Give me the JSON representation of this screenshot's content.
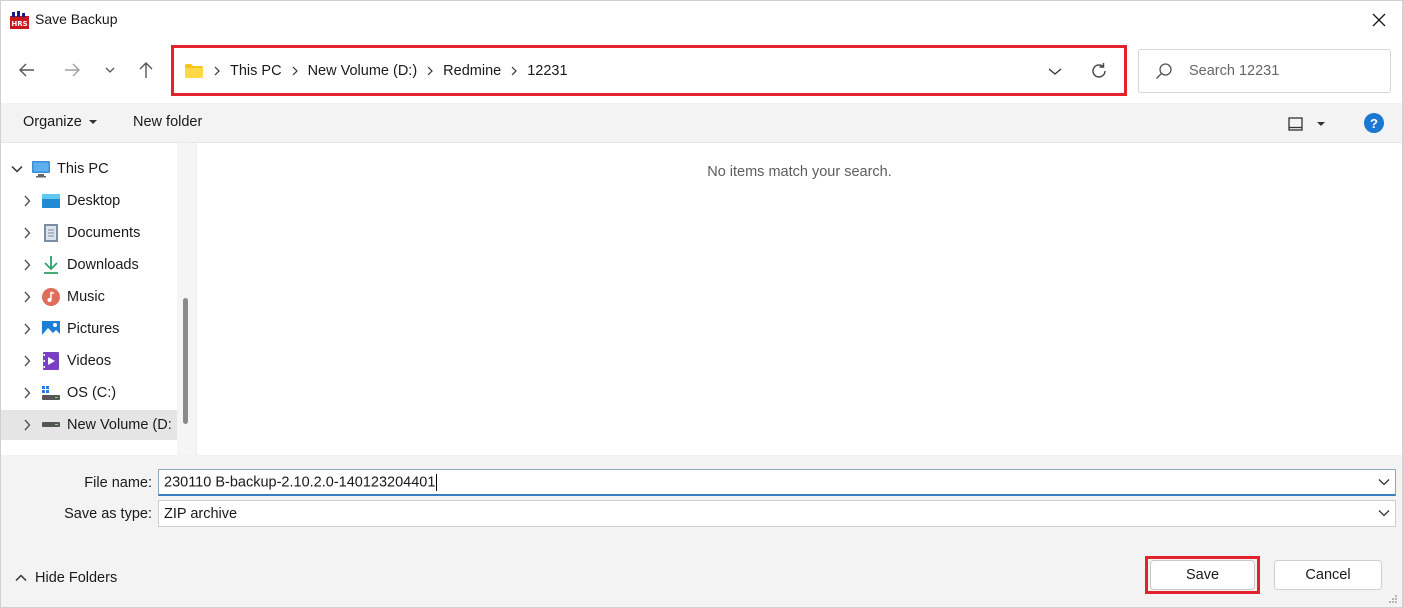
{
  "window": {
    "title": "Save Backup",
    "app_icon": "hrs-app-icon",
    "close_icon": "close-icon"
  },
  "nav": {
    "back_icon": "arrow-left-icon",
    "forward_icon": "arrow-right-icon",
    "recent_icon": "chevron-down-icon",
    "up_icon": "arrow-up-icon"
  },
  "address": {
    "folder_icon": "folder-icon",
    "crumbs": [
      "This PC",
      "New Volume (D:)",
      "Redmine",
      "12231"
    ],
    "dropdown_icon": "chevron-down-icon",
    "refresh_icon": "refresh-icon",
    "highlight_color": "#e3232c"
  },
  "search": {
    "placeholder": "Search 12231",
    "icon": "search-icon"
  },
  "commands": {
    "organize": "Organize",
    "new_folder": "New folder",
    "view_icon": "view-layout-icon",
    "help_label": "?",
    "help_color": "#1b78d0"
  },
  "tree": {
    "items": [
      {
        "label": "This PC",
        "icon": "computer-icon",
        "expanded": true,
        "level": 0
      },
      {
        "label": "Desktop",
        "icon": "desktop-icon",
        "level": 1
      },
      {
        "label": "Documents",
        "icon": "documents-icon",
        "level": 1
      },
      {
        "label": "Downloads",
        "icon": "downloads-icon",
        "level": 1
      },
      {
        "label": "Music",
        "icon": "music-icon",
        "level": 1
      },
      {
        "label": "Pictures",
        "icon": "pictures-icon",
        "level": 1
      },
      {
        "label": "Videos",
        "icon": "videos-icon",
        "level": 1
      },
      {
        "label": "OS (C:)",
        "icon": "os-drive-icon",
        "level": 1
      },
      {
        "label": "New Volume (D:",
        "icon": "drive-icon",
        "level": 1,
        "selected": true
      }
    ]
  },
  "main": {
    "empty_message": "No items match your search."
  },
  "form": {
    "filename_label": "File name:",
    "filename_value": "230110 B-backup-2.10.2.0-140123204401",
    "type_label": "Save as type:",
    "type_value": "ZIP archive"
  },
  "footer": {
    "hide_folders": "Hide Folders",
    "save": "Save",
    "cancel": "Cancel"
  }
}
